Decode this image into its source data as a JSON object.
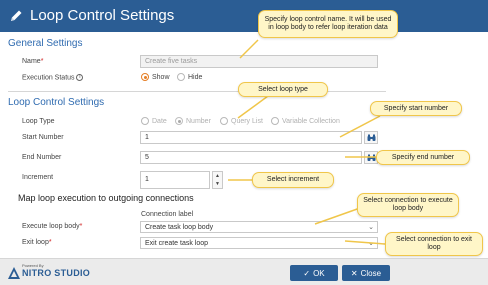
{
  "window": {
    "title": "Loop Control Settings"
  },
  "general": {
    "heading": "General Settings",
    "name_label": "Name",
    "name_placeholder": "Create five tasks",
    "status_label": "Execution Status",
    "status_options": [
      "Show",
      "Hide"
    ],
    "status_selected": "Show"
  },
  "loop": {
    "heading": "Loop Control Settings",
    "type_label": "Loop Type",
    "type_options": [
      "Date",
      "Number",
      "Query List",
      "Variable Collection"
    ],
    "type_selected": "Number",
    "start_label": "Start Number",
    "start_value": "1",
    "end_label": "End Number",
    "end_value": "5",
    "increment_label": "Increment",
    "increment_value": "1"
  },
  "mapping": {
    "heading": "Map loop execution to outgoing connections",
    "column_label": "Connection label",
    "body_label": "Execute loop body",
    "body_value": "Create task loop body",
    "exit_label": "Exit loop",
    "exit_value": "Exit create task loop"
  },
  "callouts": {
    "name": "Specify loop control name. It will be used in loop body to refer loop iteration data",
    "type": "Select loop type",
    "start": "Specify start number",
    "end": "Specify end number",
    "increment": "Select increment",
    "body": "Select connection to execute loop body",
    "exit": "Select connection to exit loop"
  },
  "footer": {
    "powered": "Powered By",
    "brand": "NITRO STUDIO",
    "ok_label": "OK",
    "close_label": "Close"
  },
  "colors": {
    "header": "#2b5d94",
    "accent": "#e57e25",
    "callout_fill": "#fff6c8",
    "callout_border": "#f0c64a"
  }
}
